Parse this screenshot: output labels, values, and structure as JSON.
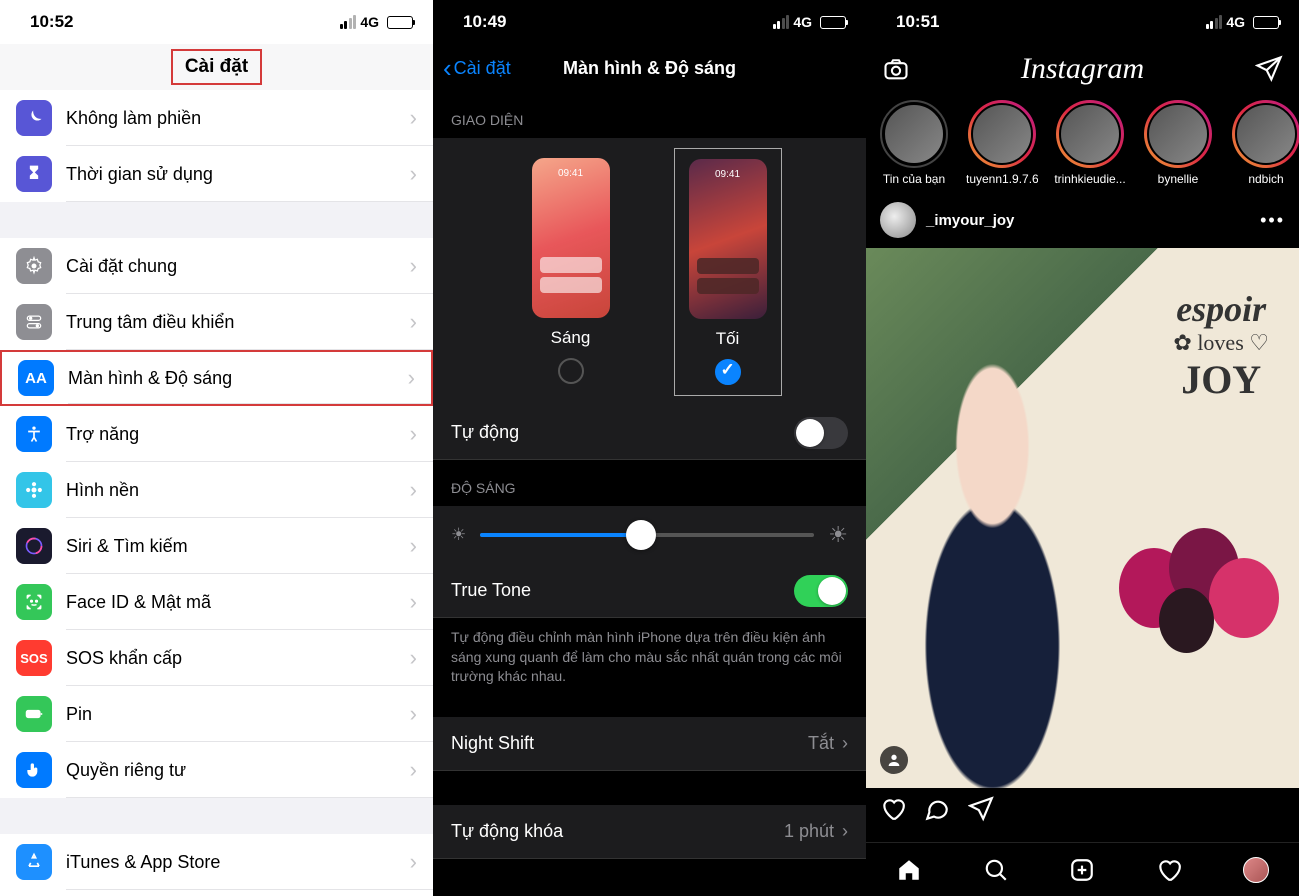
{
  "screen1": {
    "time": "10:52",
    "network": "4G",
    "title": "Cài đặt",
    "rows": [
      {
        "label": "Không làm phiền",
        "icon": "moon",
        "bg": "#5856d6"
      },
      {
        "label": "Thời gian sử dụng",
        "icon": "hourglass",
        "bg": "#5856d6"
      }
    ],
    "rows2": [
      {
        "label": "Cài đặt chung",
        "icon": "gear",
        "bg": "#8e8e93"
      },
      {
        "label": "Trung tâm điều khiển",
        "icon": "switches",
        "bg": "#8e8e93"
      },
      {
        "label": "Màn hình & Độ sáng",
        "icon": "aa",
        "bg": "#007aff",
        "highlighted": true
      },
      {
        "label": "Trợ năng",
        "icon": "accessibility",
        "bg": "#007aff"
      },
      {
        "label": "Hình nền",
        "icon": "flower",
        "bg": "#33c5e8"
      },
      {
        "label": "Siri & Tìm kiếm",
        "icon": "siri",
        "bg": "#1a1a2e"
      },
      {
        "label": "Face ID & Mật mã",
        "icon": "face",
        "bg": "#34c759"
      },
      {
        "label": "SOS khẩn cấp",
        "icon": "sos",
        "bg": "#ff3b30"
      },
      {
        "label": "Pin",
        "icon": "battery",
        "bg": "#34c759"
      },
      {
        "label": "Quyền riêng tư",
        "icon": "hand",
        "bg": "#007aff"
      }
    ],
    "rows3": [
      {
        "label": "iTunes & App Store",
        "icon": "appstore",
        "bg": "#1e90ff"
      }
    ]
  },
  "screen2": {
    "time": "10:49",
    "network": "4G",
    "back": "Cài đặt",
    "title": "Màn hình & Độ sáng",
    "section_appearance": "GIAO DIỆN",
    "opt_light": "Sáng",
    "opt_dark": "Tối",
    "preview_time": "09:41",
    "auto_label": "Tự động",
    "section_brightness": "ĐỘ SÁNG",
    "truetone_label": "True Tone",
    "truetone_desc": "Tự động điều chỉnh màn hình iPhone dựa trên điều kiện ánh sáng xung quanh để làm cho màu sắc nhất quán trong các môi trường khác nhau.",
    "nightshift_label": "Night Shift",
    "nightshift_value": "Tắt",
    "autolock_label": "Tự động khóa",
    "autolock_value": "1 phút"
  },
  "screen3": {
    "time": "10:51",
    "network": "4G",
    "logo": "Instagram",
    "stories": [
      {
        "name": "Tin của bạn",
        "own": true
      },
      {
        "name": "tuyenn1.9.7.6"
      },
      {
        "name": "trinhkieudie..."
      },
      {
        "name": "bynellie"
      },
      {
        "name": "ndbich"
      }
    ],
    "post_user": "_imyour_joy",
    "balloon_line1": "espoir",
    "balloon_line2": "loves",
    "balloon_line3": "JOY"
  }
}
